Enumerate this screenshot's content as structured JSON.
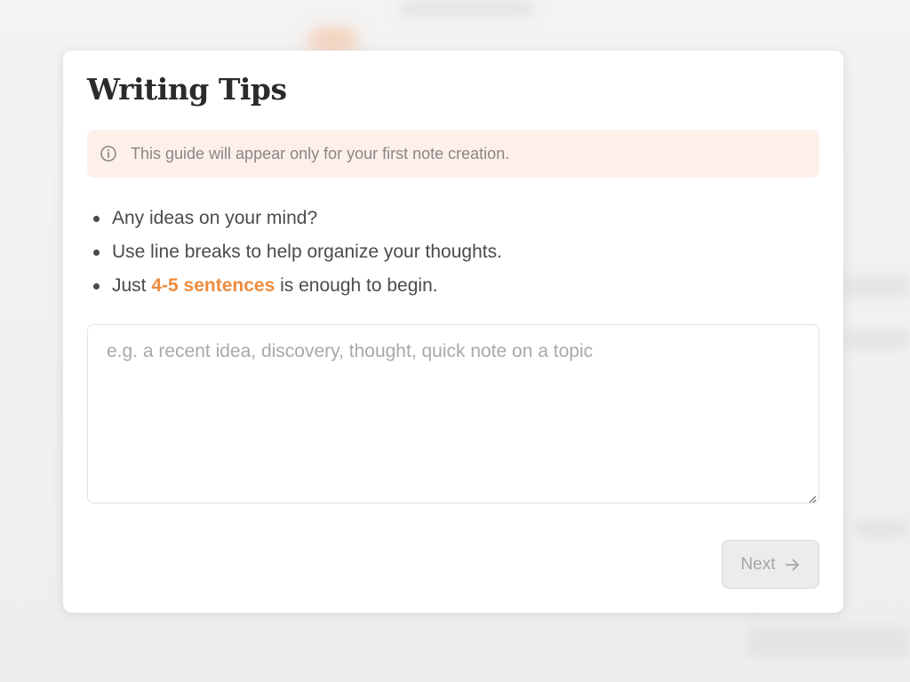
{
  "modal": {
    "title": "Writing Tips",
    "notice": {
      "icon": "info-icon",
      "text": "This guide will appear only for your first note creation."
    },
    "tips": [
      {
        "text": "Any ideas on your mind?"
      },
      {
        "text": "Use line breaks to help organize your thoughts."
      },
      {
        "prefix": "Just ",
        "highlight": "4-5 sentences",
        "suffix": " is enough to begin."
      }
    ],
    "input": {
      "placeholder": "e.g. a recent idea, discovery, thought, quick note on a topic",
      "value": ""
    },
    "next_button": {
      "label": "Next",
      "icon": "arrow-right-icon",
      "disabled": true
    }
  },
  "colors": {
    "accent": "#ef8c3e",
    "notice_bg": "#fdf0eb",
    "title": "#2b2b2b",
    "text": "#4b4b4b",
    "muted": "#8a8684",
    "button_disabled_bg": "#ececec"
  }
}
